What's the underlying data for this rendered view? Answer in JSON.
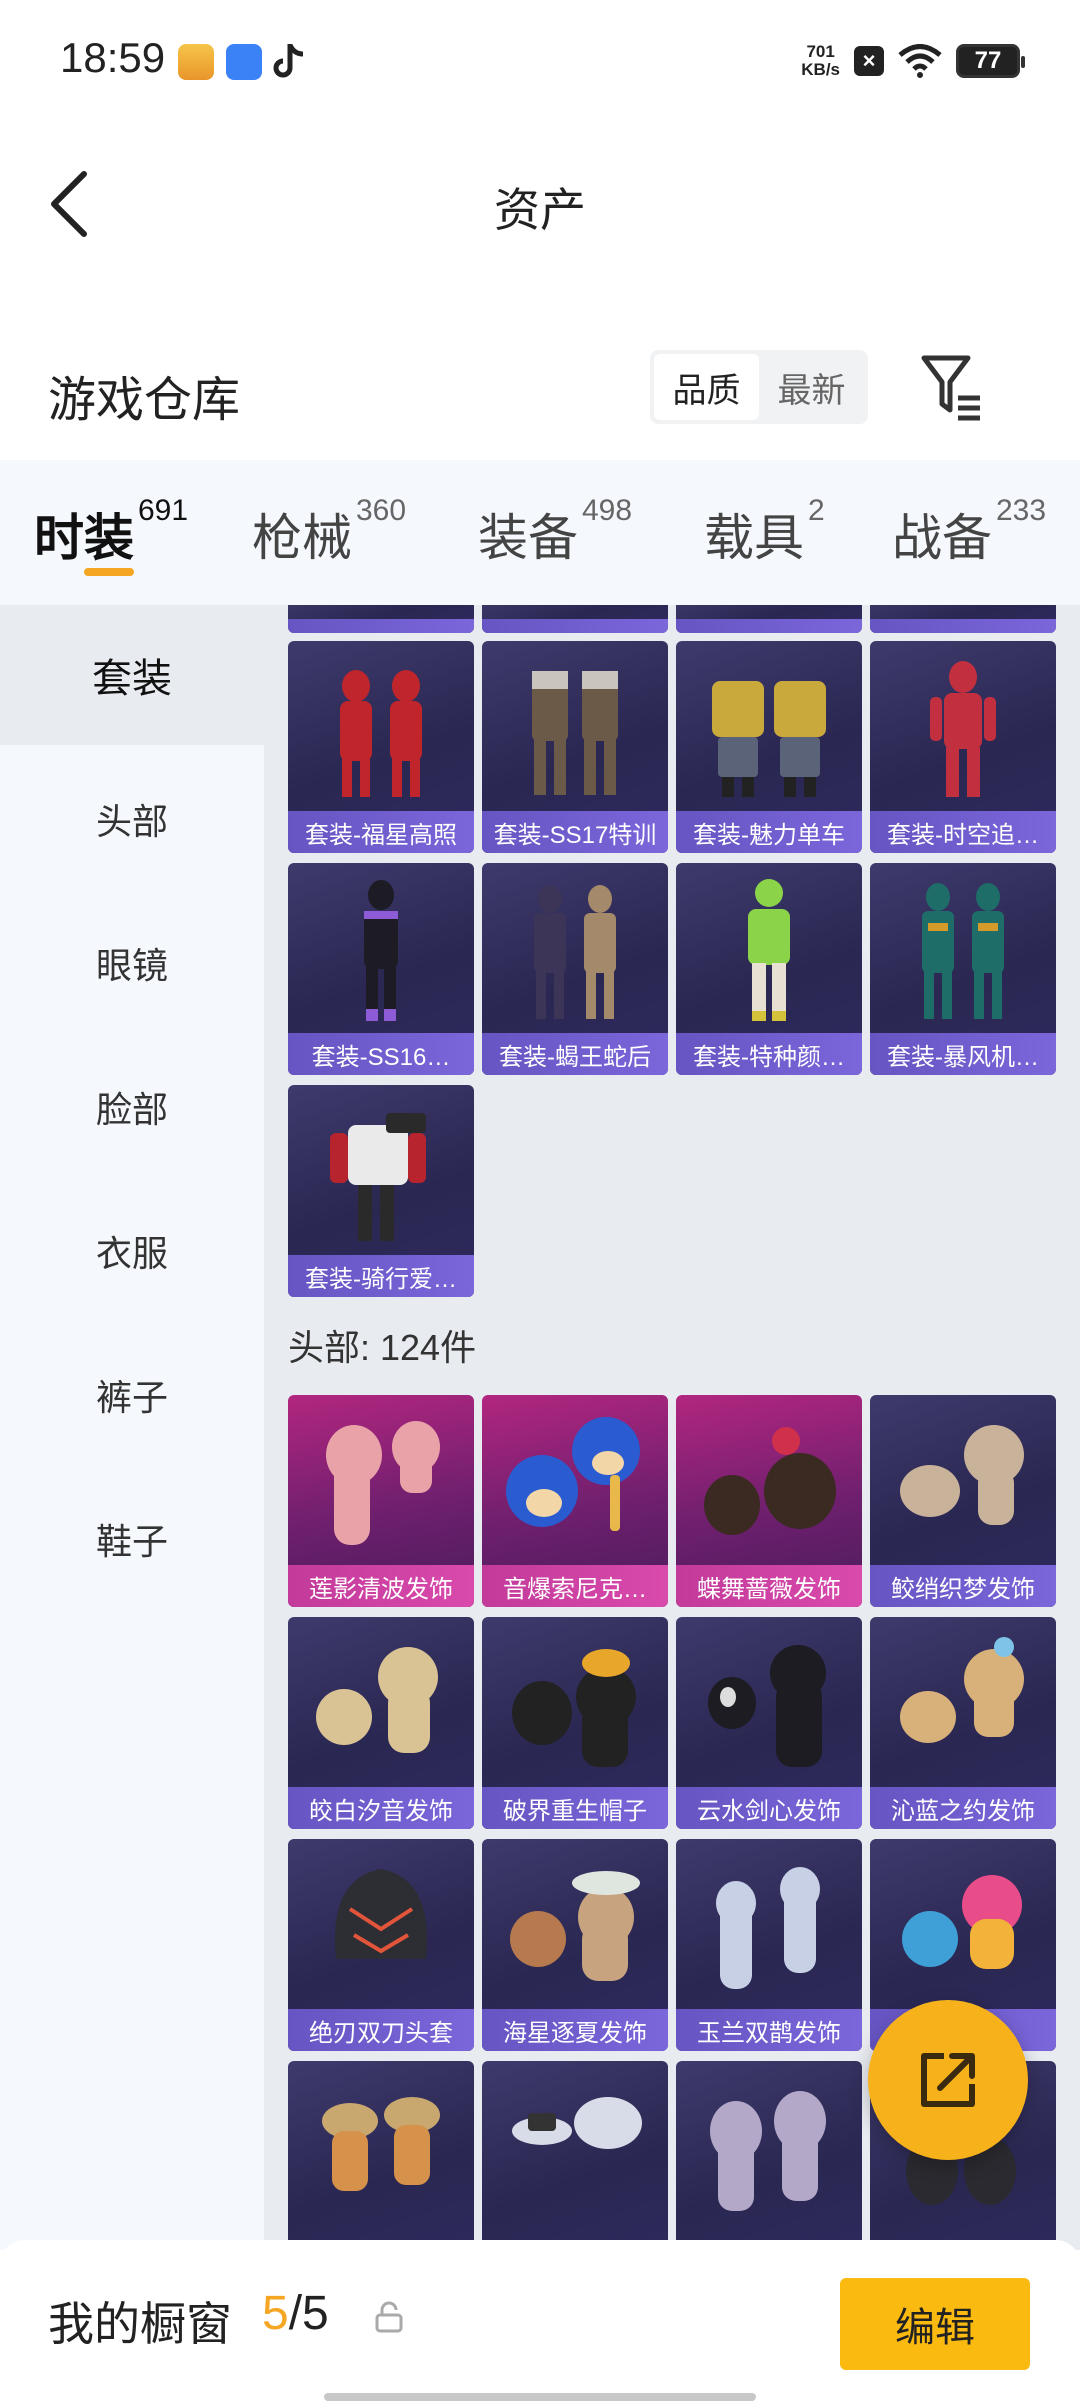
{
  "status": {
    "time": "18:59",
    "speed_top": "701",
    "speed_bottom": "KB/s",
    "battery": "77"
  },
  "header": {
    "title": "资产"
  },
  "warehouse": {
    "title": "游戏仓库",
    "sort_options": [
      "品质",
      "最新"
    ]
  },
  "tabs": [
    {
      "label": "时装",
      "count": "691"
    },
    {
      "label": "枪械",
      "count": "360"
    },
    {
      "label": "装备",
      "count": "498"
    },
    {
      "label": "载具",
      "count": "2"
    },
    {
      "label": "战备",
      "count": "233"
    }
  ],
  "sidebar": {
    "items": [
      "套装",
      "头部",
      "眼镜",
      "脸部",
      "衣服",
      "裤子",
      "鞋子"
    ]
  },
  "suits": [
    {
      "name": "套装-福星高照"
    },
    {
      "name": "套装-SS17特训"
    },
    {
      "name": "套装-魅力单车"
    },
    {
      "name": "套装-时空追…"
    },
    {
      "name": "套装-SS16…"
    },
    {
      "name": "套装-蝎王蛇后"
    },
    {
      "name": "套装-特种颜…"
    },
    {
      "name": "套装-暴风机…"
    },
    {
      "name": "套装-骑行爱…"
    }
  ],
  "head_section": {
    "title": "头部: 124件"
  },
  "heads": [
    {
      "name": "莲影清波发饰"
    },
    {
      "name": "音爆索尼克…"
    },
    {
      "name": "蝶舞蔷薇发饰"
    },
    {
      "name": "鲛绡织梦发饰"
    },
    {
      "name": "皎白汐音发饰"
    },
    {
      "name": "破界重生帽子"
    },
    {
      "name": "云水剑心发饰"
    },
    {
      "name": "沁蓝之约发饰"
    },
    {
      "name": "绝刃双刀头套"
    },
    {
      "name": "海星逐夏发饰"
    },
    {
      "name": "玉兰双鹊发饰"
    },
    {
      "name": ""
    }
  ],
  "showcase": {
    "title": "我的橱窗",
    "used": "5",
    "sep_total": "/5",
    "edit_label": "编辑"
  },
  "colors": {
    "accent": "#f5a623",
    "card_purple": "#2a2752",
    "card_pink": "#b2267f",
    "label_purple": "#7b66da"
  }
}
